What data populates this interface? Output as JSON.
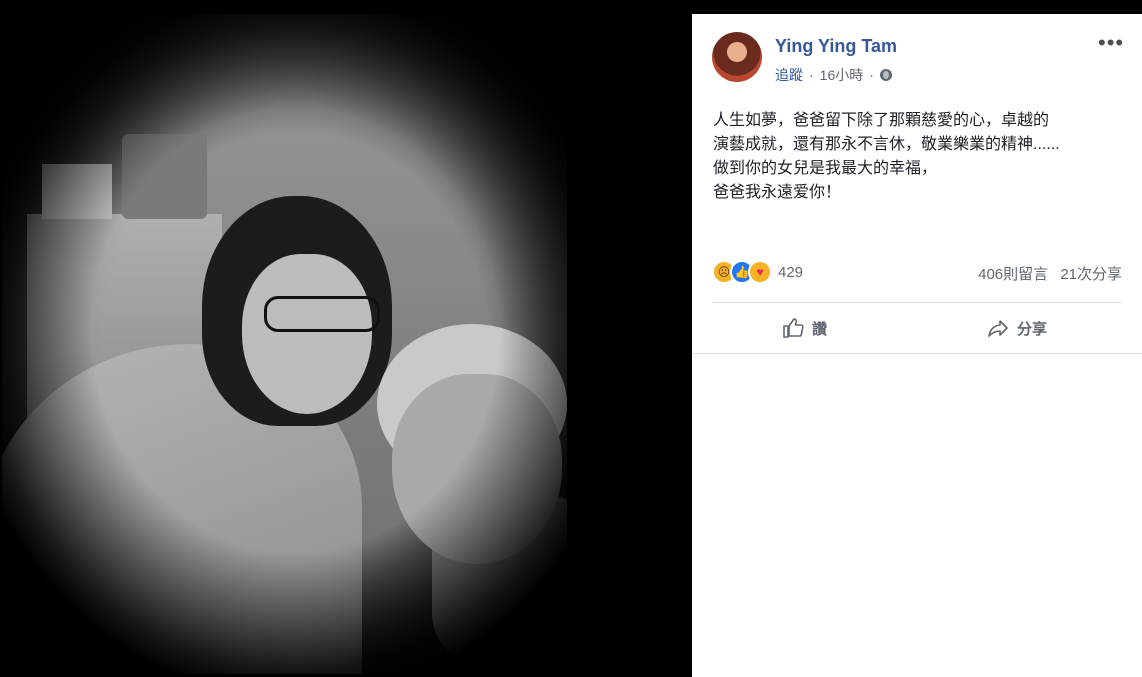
{
  "post": {
    "author": "Ying Ying Tam",
    "follow_label": "追蹤",
    "separator": "·",
    "time": "16小時",
    "more_label": "•••",
    "text_lines": [
      "人生如夢，爸爸留下除了那顆慈愛的心，卓越的",
      "演藝成就，還有那永不言休，敬業樂業的精神......",
      "做到你的女兒是我最大的幸福，",
      "爸爸我永遠爱你！"
    ]
  },
  "reactions": {
    "icons": [
      "sad-icon",
      "like-icon",
      "care-icon"
    ],
    "count": "429",
    "comments": "406則留言",
    "shares": "21次分享"
  },
  "actions": {
    "like_label": "讚",
    "share_label": "分享"
  },
  "colors": {
    "author": "#365899",
    "meta": "#606770",
    "text": "#1d2129",
    "background": "#000000"
  }
}
